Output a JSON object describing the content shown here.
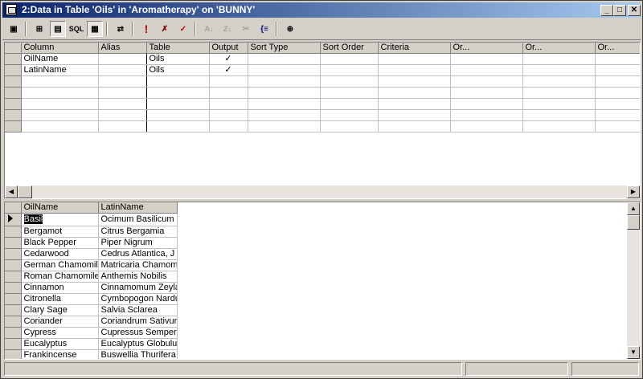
{
  "window": {
    "title": "2:Data in Table 'Oils' in 'Aromatherapy' on 'BUNNY'"
  },
  "titlebar_buttons": {
    "minimize": "_",
    "maximize": "□",
    "close": "✕"
  },
  "toolbar": {
    "tools": [
      {
        "name": "properties-tool",
        "glyph": "▣"
      },
      {
        "name": "show-diagram-pane-tool",
        "glyph": "⊞"
      },
      {
        "name": "show-grid-pane-tool",
        "glyph": "▤"
      },
      {
        "name": "show-sql-pane-tool",
        "glyph": "SQL"
      },
      {
        "name": "show-results-pane-tool",
        "glyph": "▦"
      },
      {
        "name": "change-query-type-tool",
        "glyph": "⇄"
      },
      {
        "name": "run-tool",
        "glyph": "!"
      },
      {
        "name": "cancel-query-tool",
        "glyph": "✗"
      },
      {
        "name": "verify-sql-tool",
        "glyph": "✓"
      },
      {
        "name": "sort-ascending-tool",
        "glyph": "A↓"
      },
      {
        "name": "sort-descending-tool",
        "glyph": "Z↓"
      },
      {
        "name": "remove-filter-tool",
        "glyph": "✂"
      },
      {
        "name": "group-by-tool",
        "glyph": "{≡"
      },
      {
        "name": "add-table-tool",
        "glyph": "⊕"
      }
    ]
  },
  "criteria_grid": {
    "headers": [
      "Column",
      "Alias",
      "Table",
      "Output",
      "Sort Type",
      "Sort Order",
      "Criteria",
      "Or...",
      "Or...",
      "Or..."
    ],
    "rows": [
      [
        "OilName",
        "",
        "Oils",
        "✓",
        "",
        "",
        "",
        "",
        "",
        ""
      ],
      [
        "LatinName",
        "",
        "Oils",
        "✓",
        "",
        "",
        "",
        "",
        "",
        ""
      ],
      [
        "",
        "",
        "",
        "",
        "",
        "",
        "",
        "",
        "",
        ""
      ],
      [
        "",
        "",
        "",
        "",
        "",
        "",
        "",
        "",
        "",
        ""
      ],
      [
        "",
        "",
        "",
        "",
        "",
        "",
        "",
        "",
        "",
        ""
      ],
      [
        "",
        "",
        "",
        "",
        "",
        "",
        "",
        "",
        "",
        ""
      ],
      [
        "",
        "",
        "",
        "",
        "",
        "",
        "",
        "",
        "",
        ""
      ]
    ]
  },
  "results_grid": {
    "headers": [
      "OilName",
      "LatinName"
    ],
    "rows": [
      [
        "Basil",
        "Ocimum Basilicum"
      ],
      [
        "Bergamot",
        "Citrus Bergamia"
      ],
      [
        "Black Pepper",
        "Piper Nigrum"
      ],
      [
        "Cedarwood",
        "Cedrus Atlantica, J"
      ],
      [
        "German Chamomile",
        "Matricaria Chamom"
      ],
      [
        "Roman Chamomile",
        "Anthemis Nobilis"
      ],
      [
        "Cinnamon",
        "Cinnamomum Zeyla"
      ],
      [
        "Citronella",
        "Cymbopogon Nardu"
      ],
      [
        "Clary Sage",
        "Salvia Sclarea"
      ],
      [
        "Coriander",
        "Coriandrum Sativur"
      ],
      [
        "Cypress",
        "Cupressus Semperv"
      ],
      [
        "Eucalyptus",
        "Eucalyptus Globulus"
      ],
      [
        "Frankincense",
        "Buswellia Thurifera"
      ]
    ]
  }
}
